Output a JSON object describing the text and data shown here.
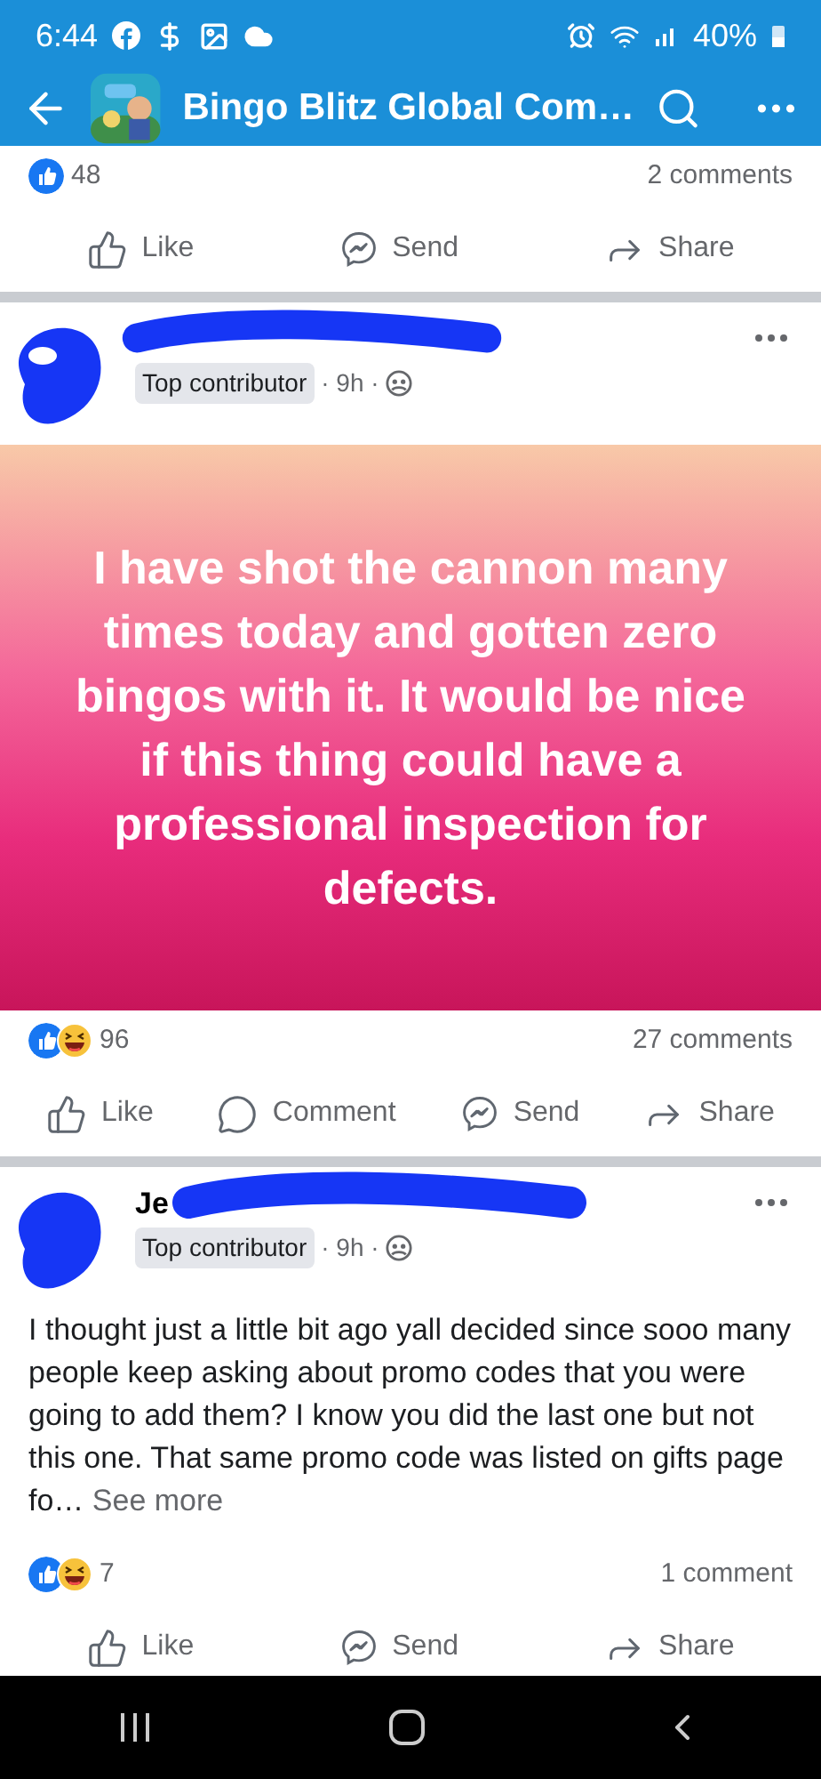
{
  "status_bar": {
    "time": "6:44",
    "battery": "40%"
  },
  "app_bar": {
    "title": "Bingo Blitz Global Com…"
  },
  "posts": [
    {
      "kind": "tail",
      "reactions": [
        {
          "kind": "like"
        }
      ],
      "reaction_count": "48",
      "comments": "2 comments",
      "actions": [
        {
          "kind": "like",
          "label": "Like"
        },
        {
          "kind": "send",
          "label": "Send"
        },
        {
          "kind": "share",
          "label": "Share"
        }
      ]
    },
    {
      "kind": "image_text",
      "badge": "Top contributor",
      "time": "· 9h ·",
      "text": "I have shot the cannon many times today and gotten zero bingos with it. It would be nice if this thing could have a professional inspection for defects.",
      "reactions": [
        {
          "kind": "like"
        },
        {
          "kind": "haha"
        }
      ],
      "reaction_count": "96",
      "comments": "27 comments",
      "actions": [
        {
          "kind": "like",
          "label": "Like"
        },
        {
          "kind": "comment",
          "label": "Comment"
        },
        {
          "kind": "send",
          "label": "Send"
        },
        {
          "kind": "share",
          "label": "Share"
        }
      ]
    },
    {
      "kind": "text",
      "author": "Je",
      "badge": "Top contributor",
      "time": "· 9h ·",
      "text": "I thought just a little bit ago yall decided since sooo many people keep asking about promo codes that you were going to add them? I know you did the last one but not this one. That same promo code was listed on gifts page fo…",
      "see_more": "See more",
      "reactions": [
        {
          "kind": "like"
        },
        {
          "kind": "haha"
        }
      ],
      "reaction_count": "7",
      "comments": "1 comment",
      "actions": [
        {
          "kind": "like",
          "label": "Like"
        },
        {
          "kind": "send",
          "label": "Send"
        },
        {
          "kind": "share",
          "label": "Share"
        }
      ]
    }
  ]
}
